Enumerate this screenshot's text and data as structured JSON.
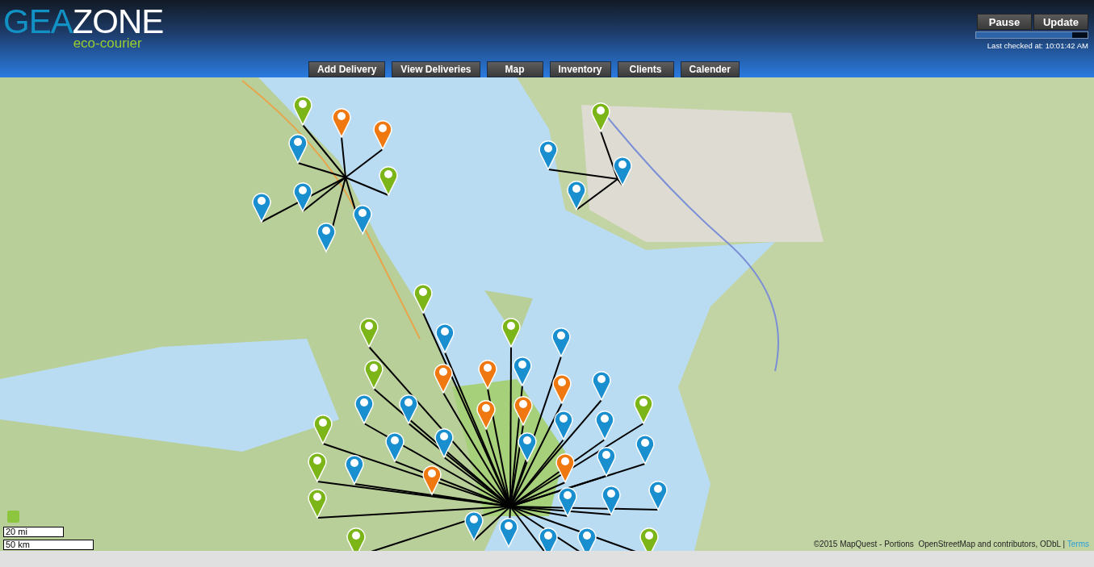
{
  "logo": {
    "brand_left": "GEA",
    "brand_right": "ZONE",
    "tagline": "eco-courier"
  },
  "controls": {
    "buttons": [
      "Pause",
      "Update"
    ],
    "progress": {
      "level": 0.86
    },
    "last_checked": "Last checked at: 10:01:42 AM"
  },
  "nav": [
    "Add Delivery",
    "View Deliveries",
    "Map",
    "Inventory",
    "Clients",
    "Calender"
  ],
  "map": {
    "scale": [
      "20 mi",
      "50 km"
    ],
    "attribution": "©2015 MapQuest - Portions  OpenStreetMap and contributors, ODbL | ",
    "terms_link": "Terms"
  }
}
